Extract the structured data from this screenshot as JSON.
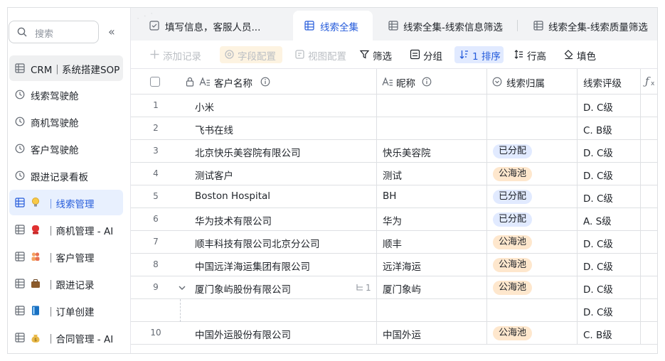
{
  "sidebar": {
    "search_placeholder": "搜索",
    "items": [
      {
        "label": "CRM｜系统搭建SOP",
        "icon": "table-icon",
        "emoji": ""
      },
      {
        "label": "线索驾驶舱",
        "icon": "dashboard-icon",
        "emoji": ""
      },
      {
        "label": "商机驾驶舱",
        "icon": "dashboard-icon",
        "emoji": ""
      },
      {
        "label": "客户驾驶舱",
        "icon": "dashboard-icon",
        "emoji": ""
      },
      {
        "label": "跟进记录看板",
        "icon": "dashboard-icon",
        "emoji": ""
      },
      {
        "label": "｜线索管理",
        "icon": "table-icon",
        "emoji": "lightbulb"
      },
      {
        "label": "｜商机管理 - AI",
        "icon": "table-icon",
        "emoji": "boxing-glove"
      },
      {
        "label": "｜客户管理",
        "icon": "table-icon",
        "emoji": "people"
      },
      {
        "label": "｜跟进记录",
        "icon": "table-icon",
        "emoji": "briefcase"
      },
      {
        "label": "｜订单创建",
        "icon": "table-icon",
        "emoji": "book"
      },
      {
        "label": "｜合同管理 - AI",
        "icon": "table-icon",
        "emoji": "money-bag"
      }
    ]
  },
  "tabs": [
    {
      "label": "填写信息，客服人员...",
      "icon": "form-icon"
    },
    {
      "label": "线索全集",
      "icon": "grid-icon"
    },
    {
      "label": "线索全集-线索信息筛选",
      "icon": "grid-icon"
    },
    {
      "label": "线索全集-线索质量筛选",
      "icon": "grid-icon"
    }
  ],
  "toolbar": {
    "add_record": "添加记录",
    "field_config": "字段配置",
    "view_config": "视图配置",
    "filter": "筛选",
    "group": "分组",
    "sort": "1 排序",
    "row_height": "行高",
    "fill": "填色"
  },
  "columns": {
    "customer_name": "客户名称",
    "nickname": "昵称",
    "lead_owner": "线索归属",
    "lead_rating": "线索评级"
  },
  "rows": [
    {
      "num": "1",
      "name": "小米",
      "nick": "",
      "owner": "",
      "rating": "D. C级"
    },
    {
      "num": "2",
      "name": "飞书在线",
      "nick": "",
      "owner": "",
      "rating": "C. B级"
    },
    {
      "num": "3",
      "name": "北京快乐美容院有限公司",
      "nick": "快乐美容院",
      "owner": "已分配",
      "rating": "D. C级"
    },
    {
      "num": "4",
      "name": "测试客户",
      "nick": "测试",
      "owner": "公海池",
      "rating": "D. C级"
    },
    {
      "num": "5",
      "name": "Boston Hospital",
      "nick": "BH",
      "owner": "已分配",
      "rating": "D. C级"
    },
    {
      "num": "6",
      "name": "华为技术有限公司",
      "nick": "华为",
      "owner": "已分配",
      "rating": "A. S级"
    },
    {
      "num": "7",
      "name": "顺丰科技有限公司北京分公司",
      "nick": "顺丰",
      "owner": "公海池",
      "rating": "D. C级"
    },
    {
      "num": "8",
      "name": "中国远洋海运集团有限公司",
      "nick": "远洋海运",
      "owner": "公海池",
      "rating": "D. C级"
    },
    {
      "num": "9",
      "name": "厦门象屿股份有限公司",
      "nick": "厦门象屿",
      "owner": "公海池",
      "rating": "D. C级",
      "sub": "1"
    },
    {
      "num": "",
      "name": "",
      "nick": "",
      "owner": "",
      "rating": "D. C级"
    },
    {
      "num": "10",
      "name": "中国外运股份有限公司",
      "nick": "中国外运",
      "owner": "公海池",
      "rating": "C. B级"
    }
  ],
  "colors": {
    "accent": "#245bdb",
    "assigned_bg": "#e1eaff",
    "pool_bg": "#fee7cd"
  }
}
